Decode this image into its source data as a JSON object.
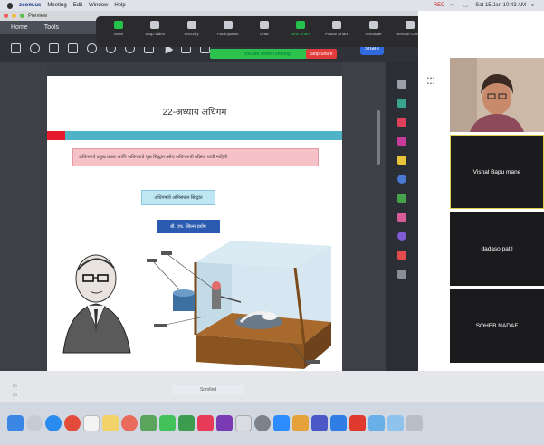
{
  "menubar": {
    "app_name": "zoom.us",
    "items": [
      "Meeting",
      "Edit",
      "Window",
      "Help"
    ],
    "status_text": "REC",
    "clock": "Sat 15 Jan 10:43 AM"
  },
  "pdf_app": {
    "title": "Preview",
    "menu": [
      "Home",
      "Tools"
    ],
    "share_label": "Share",
    "page": {
      "title": "22-अध्याय अधिगम",
      "pink_text": "अधिगमाचे प्रमुख प्रकार आणि अधिगमाचे मूळ सिद्धांत तसेच अधिगमाची प्रक्रिया यांची माहिती",
      "cyan_text": "अधिगमाचे अभिसंधान सिद्धांत",
      "blue_text": "बी. एफ. स्किनर प्रयोग"
    },
    "scroll_label": "Scrolled"
  },
  "zoom_toolbar": {
    "buttons": [
      {
        "label": "Mute",
        "icon": "microphone-icon"
      },
      {
        "label": "Stop Video",
        "icon": "video-camera-icon"
      },
      {
        "label": "Security",
        "icon": "shield-icon"
      },
      {
        "label": "Participants",
        "icon": "participants-icon"
      },
      {
        "label": "Chat",
        "icon": "chat-bubble-icon"
      },
      {
        "label": "New Share",
        "icon": "share-screen-icon"
      },
      {
        "label": "Pause Share",
        "icon": "pause-icon"
      },
      {
        "label": "Annotate",
        "icon": "pencil-icon"
      },
      {
        "label": "Remote Control",
        "icon": "pointer-icon"
      },
      {
        "label": "More",
        "icon": "more-dots-icon"
      }
    ],
    "banner": "You are screen sharing",
    "stop_share": "Stop Share"
  },
  "participants": [
    {
      "name": "Vishal Bapu mane"
    },
    {
      "name": "dadaso patil"
    },
    {
      "name": "SOHEB NADAF"
    }
  ],
  "colors": {
    "zoom_green": "#24c24a",
    "stop_red": "#e23b3b",
    "page_red": "#e6192d",
    "page_teal": "#4fb3c8"
  },
  "dock_apps": [
    "finder-icon",
    "launchpad-icon",
    "safari-icon",
    "chrome-icon",
    "calendar-icon",
    "notes-icon",
    "photos-icon",
    "maps-icon",
    "messages-icon",
    "facetime-icon",
    "music-icon",
    "onenote-icon",
    "screenshot-icon",
    "settings-icon",
    "zoom-icon",
    "preview-icon",
    "teams-icon",
    "app-store-icon",
    "folder-icon",
    "downloads-icon",
    "trash-icon"
  ]
}
